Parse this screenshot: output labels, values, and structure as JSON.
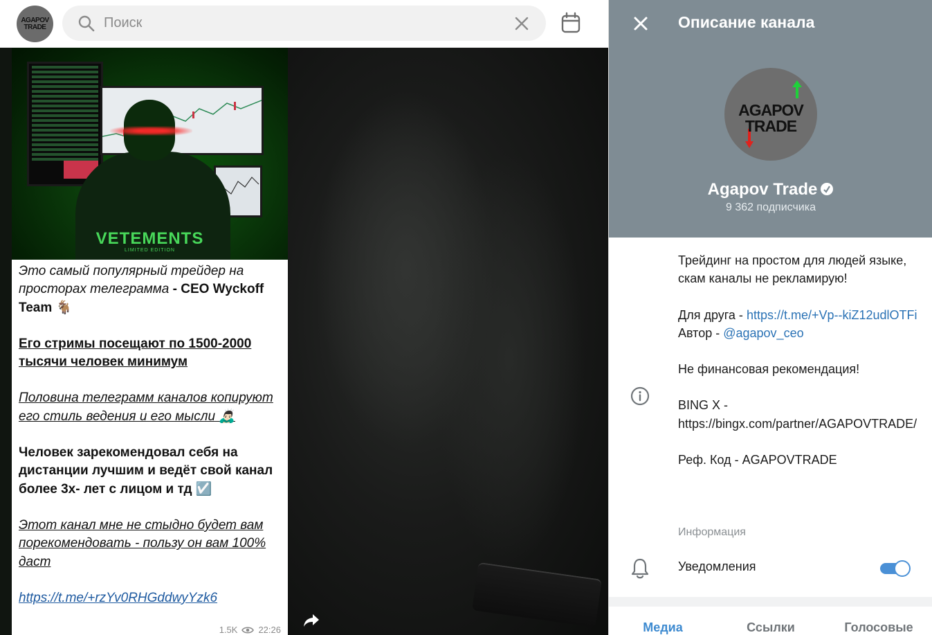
{
  "top_bar": {
    "avatar_logo_line1": "AGAPOV",
    "avatar_logo_line2": "TRADE",
    "search_placeholder": "Поиск"
  },
  "message": {
    "photo_shirt_text": "VETEMENTS",
    "photo_shirt_subtext": "LIMITED EDITION",
    "paragraphs": {
      "p1_italic": "Это самый популярный трейдер на просторах телеграмма",
      "p1_bold": " - CEO Wyckoff Team 🐐",
      "p2": "Его стримы посещают по 1500-2000 тысячи человек минимум ",
      "p3": "Половина телеграмм каналов копируют его стиль ведения и его мысли 🙇🏻‍♂️",
      "p4": "Человек зарекомендовал себя на дистанции лучшим и ведёт свой канал более 3х- лет с лицом и тд ☑️",
      "p5": "Этот канал мне не стыдно будет вам порекомендовать - пользу он вам 100% даст",
      "link": "https://t.me/+rzYv0RHGddwyYzk6"
    },
    "views": "1.5K",
    "time": "22:26"
  },
  "panel": {
    "title": "Описание канала",
    "avatar_logo_line1": "AGAPOV",
    "avatar_logo_line2": "TRADE",
    "channel_name": "Agapov Trade",
    "subscribers": "9 362 подписчика",
    "description": {
      "line1": "Трейдинг на простом для людей языке, скам каналы не рекламирую!",
      "friend_prefix": "Для друга - ",
      "friend_link": "https://t.me/+Vp--kiZ12udlOTFi",
      "author_prefix": "Автор - ",
      "author_link": "@agapov_ceo",
      "disclaimer": "Не финансовая рекомендация!",
      "bingx_label": "BING X -",
      "bingx_url": "https://bingx.com/partner/AGAPOVTRADE/",
      "ref_code": "Реф. Код - AGAPOVTRADE",
      "caption": "Информация"
    },
    "notifications_label": "Уведомления",
    "notifications_enabled": true,
    "tabs": [
      "Медиа",
      "Ссылки",
      "Голосовые"
    ],
    "active_tab": "Медиа"
  },
  "colors": {
    "header_bg": "#7f8c94",
    "accent": "#3d8ad0",
    "link": "#2a72b5"
  }
}
